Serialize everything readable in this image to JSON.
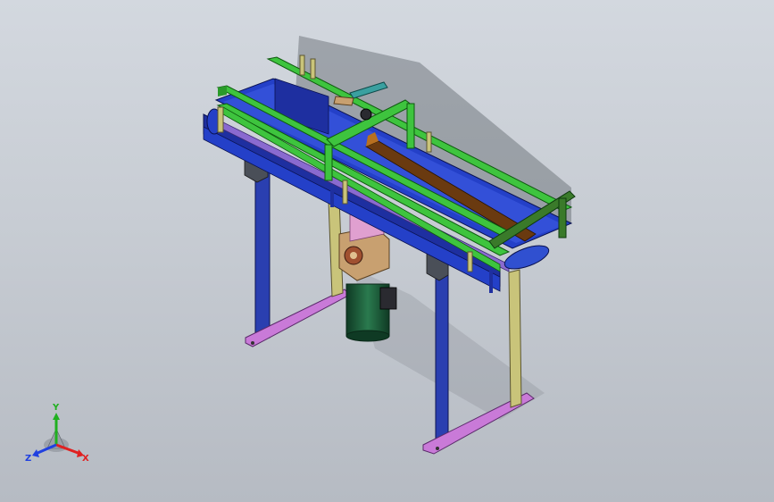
{
  "triad": {
    "x_label": "X",
    "y_label": "Y",
    "z_label": "Z",
    "x_color": "#e02020",
    "y_color": "#20b020",
    "z_color": "#2040e0"
  },
  "colors": {
    "background_top": "#d3d8df",
    "background_bottom": "#b6bbc3",
    "conveyor_body": "#2440c8",
    "guide_rail": "#3ec43e",
    "leg": "#2a3fb0",
    "support_post": "#c9c47a",
    "foot_plate": "#c97ad8",
    "motor_body": "#1f5a3a",
    "gearbox": "#c8a070",
    "belt_top": "#1e2fa0",
    "side_frame": "#8a6ad0",
    "cylinder": "#3aa0a0"
  }
}
